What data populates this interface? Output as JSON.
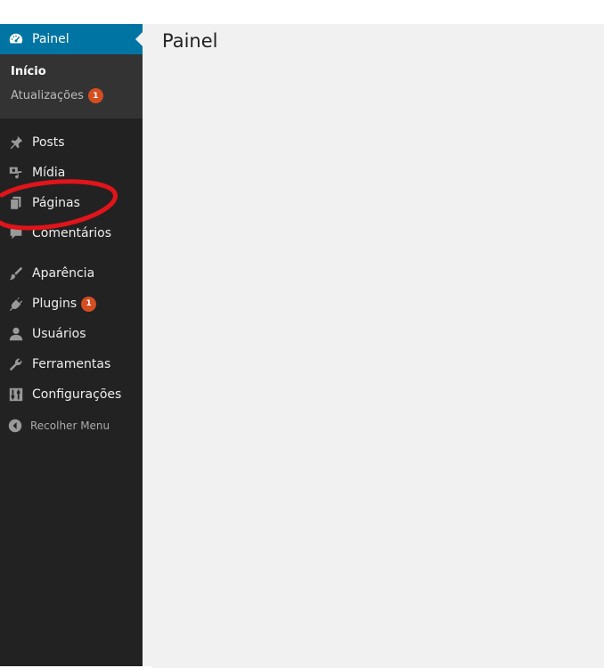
{
  "page": {
    "title": "Painel"
  },
  "sidebar": {
    "active_item": {
      "label": "Painel",
      "icon": "dashboard-icon"
    },
    "submenu": [
      {
        "label": "Início"
      },
      {
        "label": "Atualizações",
        "badge": "1"
      }
    ],
    "items": [
      {
        "label": "Posts",
        "icon": "pin-icon"
      },
      {
        "label": "Mídia",
        "icon": "media-icon"
      },
      {
        "label": "Páginas",
        "icon": "pages-icon"
      },
      {
        "label": "Comentários",
        "icon": "comment-icon"
      },
      {
        "label": "Aparência",
        "icon": "brush-icon"
      },
      {
        "label": "Plugins",
        "icon": "plugin-icon",
        "badge": "1"
      },
      {
        "label": "Usuários",
        "icon": "user-icon"
      },
      {
        "label": "Ferramentas",
        "icon": "wrench-icon"
      },
      {
        "label": "Configurações",
        "icon": "settings-icon"
      }
    ],
    "collapse_label": "Recolher Menu"
  },
  "colors": {
    "sidebar_bg": "#222222",
    "active_bg": "#0074a2",
    "badge_bg": "#d54e21",
    "annotation": "#e0141a"
  }
}
